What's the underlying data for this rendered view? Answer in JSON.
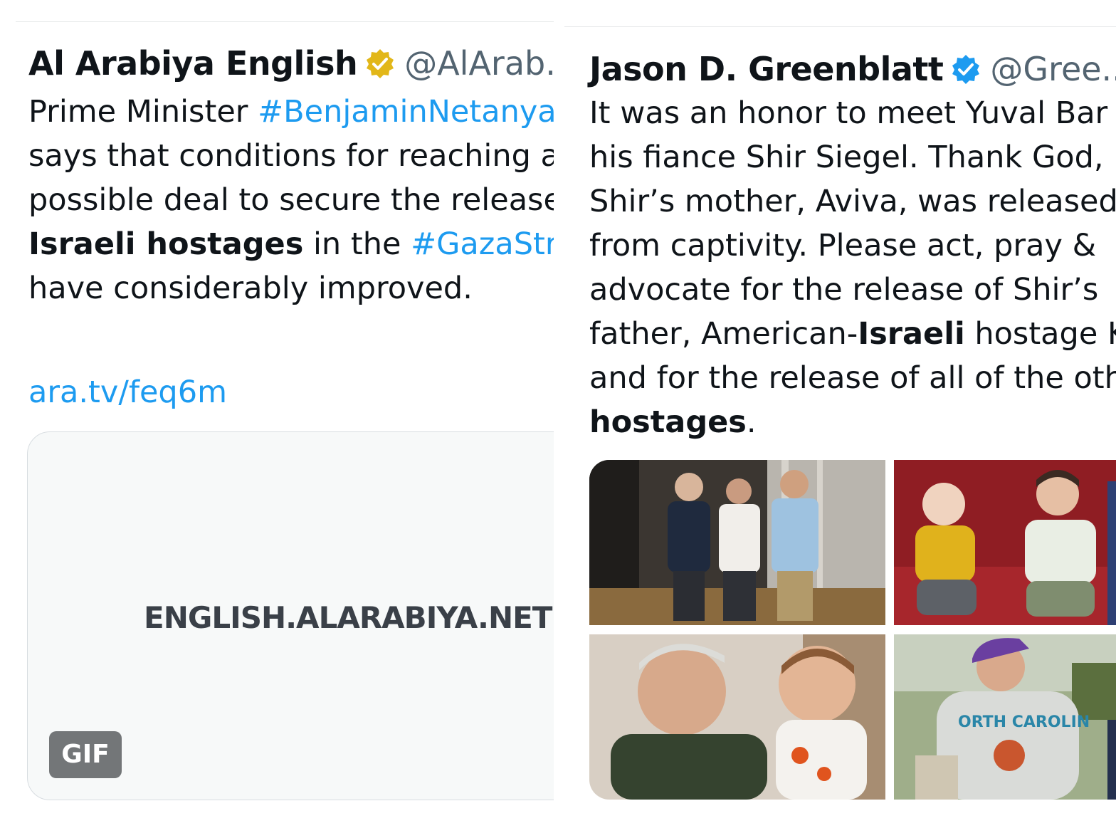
{
  "left_tweet": {
    "author_name": "Al Arabiya English",
    "handle": "@AlArab...",
    "text_lines": [
      [
        {
          "t": "Prime Minister "
        },
        {
          "t": "#BenjaminNetanyahu",
          "s": "tag"
        }
      ],
      [
        {
          "t": "says that conditions for reaching a"
        }
      ],
      [
        {
          "t": "possible deal to secure the release of"
        }
      ],
      [
        {
          "t": "Israeli hostages",
          "s": "bold"
        },
        {
          "t": " in the "
        },
        {
          "t": "#GazaStrip",
          "s": "tag"
        }
      ],
      [
        {
          "t": "have considerably improved."
        }
      ]
    ],
    "link": "ara.tv/feq6m",
    "card": {
      "domain": "ENGLISH.ALARABIYA.NET",
      "gif_badge": "GIF"
    },
    "badge_color": "#e2b719"
  },
  "right_tweet": {
    "author_name": "Jason D. Greenblatt",
    "handle": "@Gree...",
    "separator": "·",
    "text_lines": [
      [
        {
          "t": "It was an honor to meet Yuval Bar"
        }
      ],
      [
        {
          "t": "his fiance Shir Siegel. Thank God,"
        }
      ],
      [
        {
          "t": "Shir’s mother, Aviva, was released"
        }
      ],
      [
        {
          "t": "from captivity. Please act, pray &"
        }
      ],
      [
        {
          "t": "advocate for the release of Shir’s"
        }
      ],
      [
        {
          "t": "father, American-"
        },
        {
          "t": "Israeli",
          "s": "bold"
        },
        {
          "t": " hostage K"
        }
      ],
      [
        {
          "t": "and for the release of all of the other"
        }
      ],
      [
        {
          "t": "hostages",
          "s": "bold"
        },
        {
          "t": "."
        }
      ]
    ],
    "photos": [
      {
        "desc": "three-people-hotel-lobby"
      },
      {
        "desc": "two-children-red-couch"
      },
      {
        "desc": "grandfather-holding-baby"
      },
      {
        "desc": "man-in-north-carolina-sweatshirt"
      }
    ],
    "badge_color": "#1d9bf0"
  }
}
